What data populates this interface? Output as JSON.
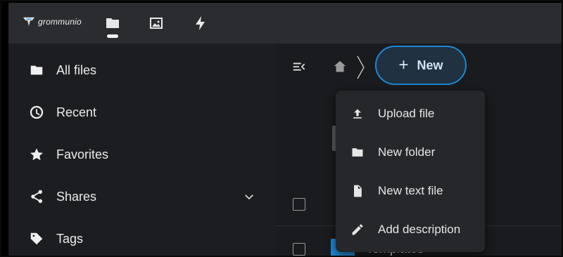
{
  "brand": {
    "name": "grommunio",
    "logo_icon": "grommunio-logo-icon"
  },
  "topbar": {
    "apps": [
      {
        "name": "files-app",
        "icon": "folder-icon",
        "active": true
      },
      {
        "name": "photos-app",
        "icon": "image-icon",
        "active": false
      },
      {
        "name": "activity-app",
        "icon": "lightning-icon",
        "active": false
      }
    ]
  },
  "sidebar": {
    "items": [
      {
        "label": "All files",
        "icon": "folder-icon"
      },
      {
        "label": "Recent",
        "icon": "clock-icon"
      },
      {
        "label": "Favorites",
        "icon": "star-icon"
      },
      {
        "label": "Shares",
        "icon": "share-icon",
        "expandable": true
      },
      {
        "label": "Tags",
        "icon": "tag-icon"
      }
    ]
  },
  "toolbar": {
    "collapse_icon": "menu-collapse-icon",
    "home_icon": "home-icon",
    "new_label": "New",
    "new_icon": "plus-icon"
  },
  "new_menu": {
    "items": [
      {
        "label": "Upload file",
        "icon": "upload-icon"
      },
      {
        "label": "New folder",
        "icon": "folder-icon"
      },
      {
        "label": "New text file",
        "icon": "document-icon"
      },
      {
        "label": "Add description",
        "icon": "pencil-icon"
      }
    ]
  },
  "file_list": {
    "rows": [
      {
        "name": ""
      },
      {
        "name": "Templates"
      }
    ]
  },
  "colors": {
    "accent": "#1e88d6",
    "topbar_bg": "#2a2c2f",
    "sidebar_bg": "#1c1d20",
    "main_bg": "#1a1b1e",
    "menu_bg": "#25272b"
  }
}
